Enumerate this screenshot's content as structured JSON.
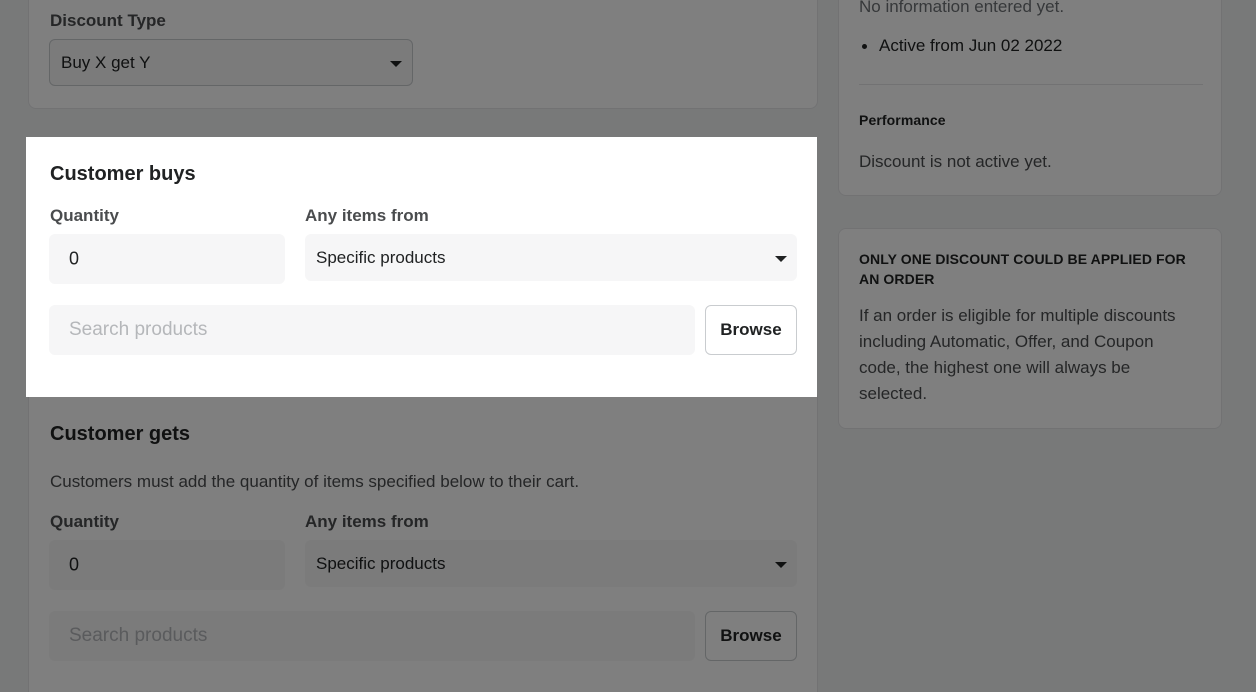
{
  "discount_type": {
    "label": "Discount Type",
    "value": "Buy X get Y"
  },
  "customer_buys": {
    "heading": "Customer buys",
    "quantity_label": "Quantity",
    "quantity_value": "0",
    "items_label": "Any items from",
    "items_value": "Specific products",
    "search_placeholder": "Search products",
    "browse_label": "Browse"
  },
  "customer_gets": {
    "heading": "Customer gets",
    "description": "Customers must add the quantity of items specified below to their cart.",
    "quantity_label": "Quantity",
    "quantity_value": "0",
    "items_label": "Any items from",
    "items_value": "Specific products",
    "search_placeholder": "Search products",
    "browse_label": "Browse"
  },
  "summary": {
    "no_info": "No information entered yet.",
    "active_from": "Active from Jun 02 2022",
    "performance_title": "Performance",
    "performance_text": "Discount is not active yet."
  },
  "notice": {
    "title": "ONLY ONE DISCOUNT COULD BE APPLIED FOR AN ORDER",
    "text": "If an order is eligible for multiple discounts including Automatic, Offer, and Coupon code, the highest one will always be selected."
  },
  "colors": {
    "overlay": "#000000",
    "card": "#ffffff",
    "field_bg": "#f6f6f7"
  }
}
